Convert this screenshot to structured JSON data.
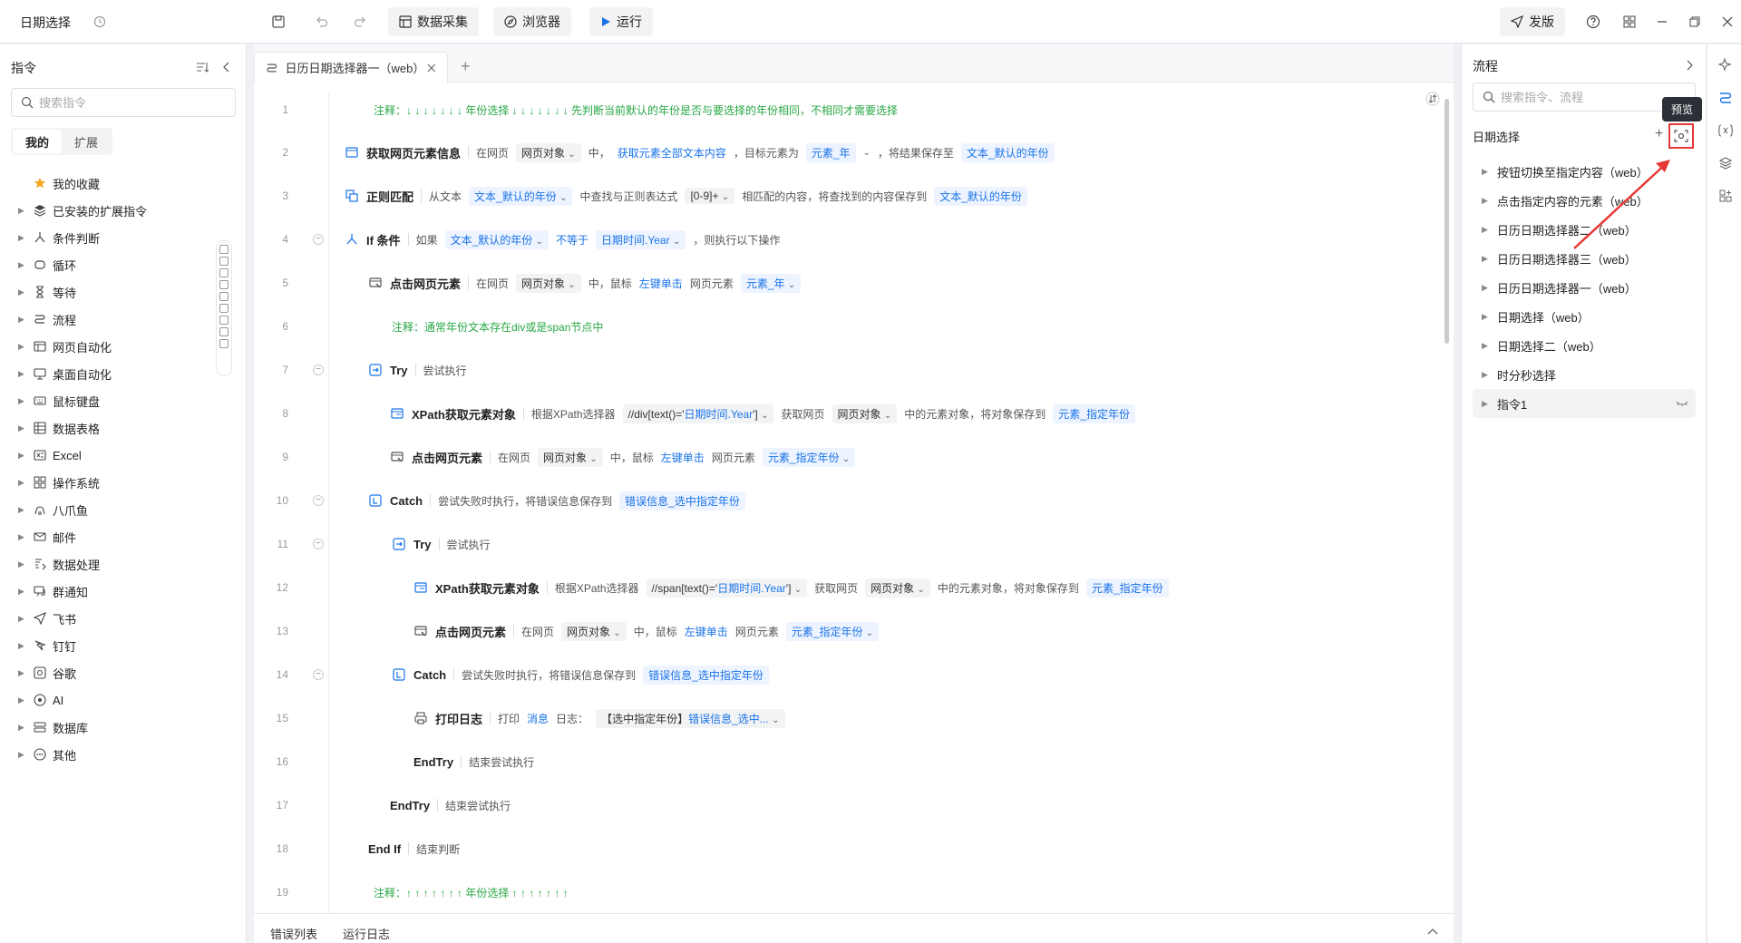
{
  "app": {
    "title": "日期选择"
  },
  "toolbar": {
    "data_collect": "数据采集",
    "browser": "浏览器",
    "run": "运行",
    "publish": "发版"
  },
  "left_panel": {
    "title": "指令",
    "search_placeholder": "搜索指令",
    "tabs": [
      "我的",
      "扩展"
    ],
    "items": [
      "我的收藏",
      "已安装的扩展指令",
      "条件判断",
      "循环",
      "等待",
      "流程",
      "网页自动化",
      "桌面自动化",
      "鼠标键盘",
      "数据表格",
      "Excel",
      "操作系统",
      "八爪鱼",
      "邮件",
      "数据处理",
      "群通知",
      "飞书",
      "钉钉",
      "谷歌",
      "AI",
      "数据库",
      "其他"
    ]
  },
  "editor": {
    "tab_label": "日历日期选择器一（web）",
    "lines": [
      {
        "n": "1",
        "comment": "注释：↓ ↓ ↓ ↓ ↓ ↓ ↓  年份选择  ↓ ↓ ↓ ↓ ↓ ↓ ↓  先判断当前默认的年份是否与要选择的年份相同，不相同才需要选择"
      },
      {
        "n": "2",
        "cmd": "获取网页元素信息",
        "t1": "在网页",
        "s1": "网页对象",
        "t2": "中，",
        "h1": "获取元素全部文本内容",
        "t3": "，目标元素为",
        "v1": "元素_年",
        "t4": "，将结果保存至",
        "v2": "文本_默认的年份"
      },
      {
        "n": "3",
        "cmd": "正则匹配",
        "t1": "从文本",
        "v1": "文本_默认的年份",
        "t2": "中查找与正则表达式",
        "s1": "[0-9]+",
        "t3": "相匹配的内容，将查找到的内容保存到",
        "v2": "文本_默认的年份"
      },
      {
        "n": "4",
        "cmd": "If 条件",
        "t1": "如果",
        "v1": "文本_默认的年份",
        "h1": "不等于",
        "v2": "日期时间.Year",
        "t2": "，则执行以下操作"
      },
      {
        "n": "5",
        "cmd": "点击网页元素",
        "t1": "在网页",
        "s1": "网页对象",
        "t2": "中，鼠标",
        "h1": "左键单击",
        "t3": "网页元素",
        "v1": "元素_年"
      },
      {
        "n": "6",
        "comment": "注释：通常年份文本存在div或是span节点中"
      },
      {
        "n": "7",
        "cmd": "Try",
        "t1": "尝试执行"
      },
      {
        "n": "8",
        "cmd": "XPath获取元素对象",
        "t1": "根据XPath选择器",
        "s1": "//div[text()='",
        "h1": "日期时间.Year",
        "s2": "']",
        "t2": "获取网页",
        "s3": "网页对象",
        "t3": "中的元素对象，将对象保存到",
        "v1": "元素_指定年份"
      },
      {
        "n": "9",
        "cmd": "点击网页元素",
        "t1": "在网页",
        "s1": "网页对象",
        "t2": "中，鼠标",
        "h1": "左键单击",
        "t3": "网页元素",
        "v1": "元素_指定年份"
      },
      {
        "n": "10",
        "cmd": "Catch",
        "t1": "尝试失败时执行，将错误信息保存到",
        "v1": "错误信息_选中指定年份"
      },
      {
        "n": "11",
        "cmd": "Try",
        "t1": "尝试执行"
      },
      {
        "n": "12",
        "cmd": "XPath获取元素对象",
        "t1": "根据XPath选择器",
        "s1": "//span[text()='",
        "h1": "日期时间.Year",
        "s2": "']",
        "t2": "获取网页",
        "s3": "网页对象",
        "t3": "中的元素对象，将对象保存到",
        "v1": "元素_指定年份"
      },
      {
        "n": "13",
        "cmd": "点击网页元素",
        "t1": "在网页",
        "s1": "网页对象",
        "t2": "中，鼠标",
        "h1": "左键单击",
        "t3": "网页元素",
        "v1": "元素_指定年份"
      },
      {
        "n": "14",
        "cmd": "Catch",
        "t1": "尝试失败时执行，将错误信息保存到",
        "v1": "错误信息_选中指定年份"
      },
      {
        "n": "15",
        "cmd": "打印日志",
        "t1": "打印",
        "h1": "消息",
        "t2": "日志：",
        "s1": "【选中指定年份】",
        "h2": "错误信息_选中..."
      },
      {
        "n": "16",
        "cmd": "EndTry",
        "t1": "结束尝试执行"
      },
      {
        "n": "17",
        "cmd": "EndTry",
        "t1": "结束尝试执行"
      },
      {
        "n": "18",
        "cmd": "End If",
        "t1": "结束判断"
      },
      {
        "n": "19",
        "comment": "注释：↑ ↑ ↑ ↑ ↑ ↑ ↑  年份选择  ↑ ↑ ↑ ↑ ↑ ↑ ↑"
      }
    ]
  },
  "bottom": {
    "tabs": [
      "错误列表",
      "运行日志"
    ]
  },
  "right_panel": {
    "title": "流程",
    "search_placeholder": "搜索指令、流程",
    "section": "日期选择",
    "tooltip": "预览",
    "items": [
      "按钮切换至指定内容（web）",
      "点击指定内容的元素（web）",
      "日历日期选择器二（web）",
      "日历日期选择器三（web）",
      "日历日期选择器一（web）",
      "日期选择（web）",
      "日期选择二（web）",
      "时分秒选择",
      "指令1"
    ]
  },
  "colors": {
    "accent": "#1a73e8",
    "comment": "#28a745",
    "highlight": "#e53935"
  }
}
